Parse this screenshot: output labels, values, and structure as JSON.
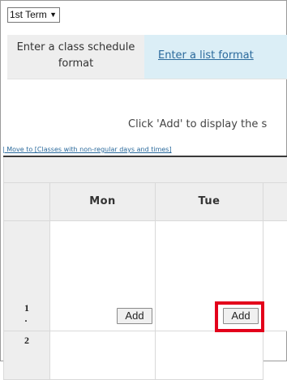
{
  "term_selector": {
    "value": "1st Term",
    "icon": "chevron-down-icon"
  },
  "format_tabs": {
    "schedule_label": "Enter a class schedule format",
    "list_label": "Enter a list format"
  },
  "hint_text": "Click 'Add' to display the s",
  "move_link": "| Move to [Classes with non-regular days and times]",
  "timetable": {
    "days": [
      "Mon",
      "Tue"
    ],
    "periods": [
      {
        "label_top": "1",
        "label_mid": "·",
        "label_bottom": "2"
      }
    ],
    "add_label": "Add"
  },
  "highlight_color": "#e3001b"
}
